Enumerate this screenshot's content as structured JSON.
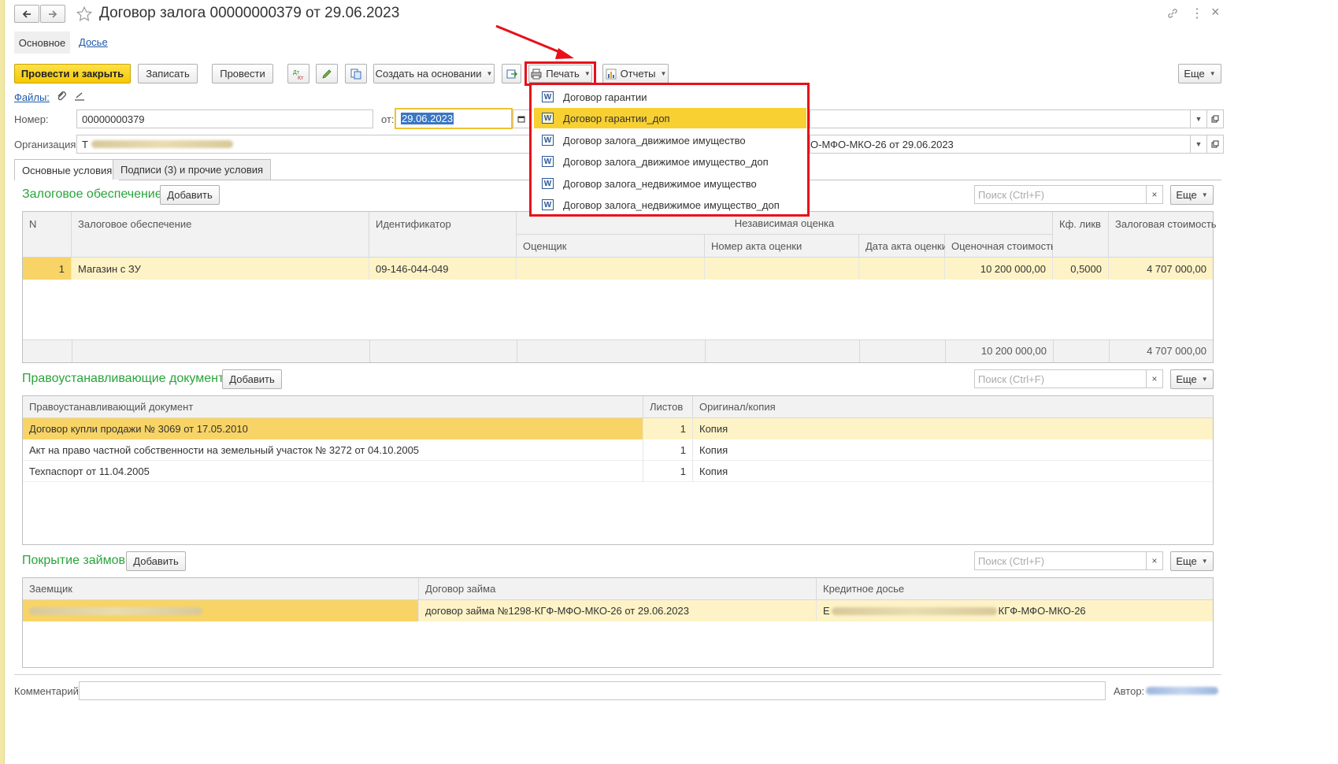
{
  "window": {
    "title": "Договор залога 00000000379 от 29.06.2023",
    "more": "⋮",
    "close": "×"
  },
  "nav_tabs": [
    "Основное",
    "Досье"
  ],
  "toolbar": {
    "post_close": "Провести и закрыть",
    "save": "Записать",
    "post": "Провести",
    "create_based": "Создать на основании",
    "print": "Печать",
    "reports": "Отчеты",
    "more": "Еще"
  },
  "files_link": "Файлы:",
  "form": {
    "number_label": "Номер:",
    "number_value": "00000000379",
    "date_label": "от:",
    "date_value": "29.06.2023",
    "org_label": "Организация:",
    "org_value_prefix": "Т",
    "right_value_2": "О-МФО-МКО-26 от 29.06.2023"
  },
  "inner_tabs": [
    "Основные условия",
    "Подписи (3) и прочие условия"
  ],
  "print_menu": {
    "icon_letter": "W",
    "selected_index": 1,
    "items": [
      "Договор гарантии",
      "Договор гарантии_доп",
      "Договор залога_движимое имущество",
      "Договор залога_движимое имущество_доп",
      "Договор залога_недвижимое имущество",
      "Договор залога_недвижимое имущество_доп"
    ]
  },
  "collateral": {
    "title": "Залоговое обеспечение:",
    "add": "Добавить",
    "search_placeholder": "Поиск (Ctrl+F)",
    "more": "Еще",
    "headers": {
      "n": "N",
      "collateral": "Залоговое обеспечение",
      "identifier": "Идентификатор",
      "independent": "Независимая оценка",
      "appraiser": "Оценщик",
      "act_number": "Номер акта оценки",
      "act_date": "Дата акта оценки",
      "appraised_value": "Оценочная стоимость",
      "liq_coef": "Кф. ликв",
      "pledge_value": "Залоговая стоимость"
    },
    "rows": [
      {
        "n": "1",
        "collateral": "Магазин с ЗУ",
        "identifier": "09-146-044-049",
        "appraiser": "",
        "act_number": "",
        "act_date": "",
        "appraised_value": "10 200 000,00",
        "liq_coef": "0,5000",
        "pledge_value": "4 707 000,00"
      }
    ],
    "totals": {
      "appraised_value": "10 200 000,00",
      "pledge_value": "4 707 000,00"
    }
  },
  "title_docs": {
    "title": "Правоустанавливающие документы:",
    "add": "Добавить",
    "search_placeholder": "Поиск (Ctrl+F)",
    "more": "Еще",
    "headers": {
      "doc": "Правоустанавливающий документ",
      "sheets": "Листов",
      "orig": "Оригинал/копия"
    },
    "rows": [
      {
        "doc": "Договор купли продажи № 3069 от 17.05.2010",
        "sheets": "1",
        "orig": "Копия"
      },
      {
        "doc": "Акт на право частной собственности на земельный участок № 3272 от 04.10.2005",
        "sheets": "1",
        "orig": "Копия"
      },
      {
        "doc": "Техпаспорт от 11.04.2005",
        "sheets": "1",
        "orig": "Копия"
      }
    ]
  },
  "loans": {
    "title": "Покрытие займов:",
    "add": "Добавить",
    "search_placeholder": "Поиск (Ctrl+F)",
    "more": "Еще",
    "headers": {
      "borrower": "Заемщик",
      "loan_contract": "Договор займа",
      "credit_file": "Кредитное досье"
    },
    "rows": [
      {
        "borrower": "",
        "loan_contract": "договор займа №1298-КГФ-МФО-МКО-26 от 29.06.2023",
        "credit_file_prefix": "Е",
        "credit_file_suffix": "КГФ-МФО-МКО-26"
      }
    ]
  },
  "footer": {
    "comment_label": "Комментарий:",
    "author_label": "Автор:"
  },
  "colors": {
    "accent_yellow": "#f5c800",
    "section_green": "#29a43a",
    "highlight_red": "#e8101a",
    "row_highlight": "#fdf3c6"
  }
}
